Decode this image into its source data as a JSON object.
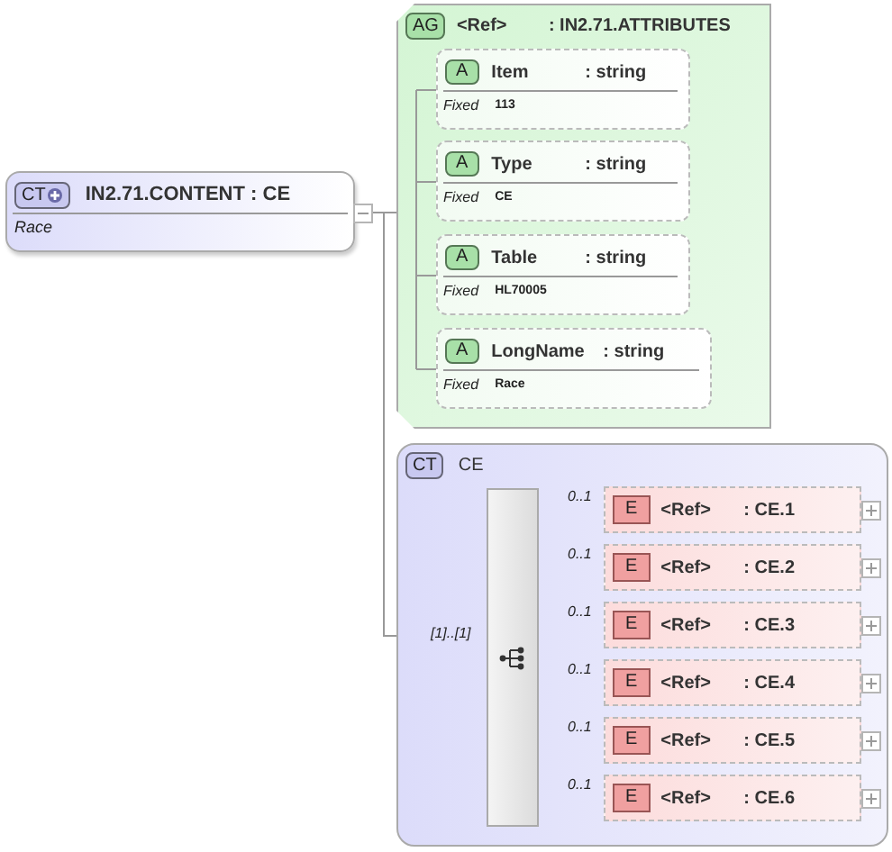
{
  "root": {
    "badge": "CT",
    "name": "IN2.71.CONTENT : CE",
    "annotation": "Race",
    "expanded": true
  },
  "attribute_group": {
    "badge": "AG",
    "ref": "<Ref>",
    "type": ": IN2.71.ATTRIBUTES",
    "attributes": [
      {
        "badge": "A",
        "name": "Item",
        "type": ": string",
        "fixed_label": "Fixed",
        "value": "113"
      },
      {
        "badge": "A",
        "name": "Type",
        "type": ": string",
        "fixed_label": "Fixed",
        "value": "CE"
      },
      {
        "badge": "A",
        "name": "Table",
        "type": ": string",
        "fixed_label": "Fixed",
        "value": "HL70005"
      },
      {
        "badge": "A",
        "name": "LongName",
        "type": ": string",
        "fixed_label": "Fixed",
        "value": "Race"
      }
    ]
  },
  "complex_type": {
    "badge": "CT",
    "name": "CE",
    "occurrence": "[1]..[1]",
    "elements": [
      {
        "cardinality": "0..1",
        "badge": "E",
        "ref": "<Ref>",
        "type": ": CE.1",
        "expanded": false
      },
      {
        "cardinality": "0..1",
        "badge": "E",
        "ref": "<Ref>",
        "type": ": CE.2",
        "expanded": false
      },
      {
        "cardinality": "0..1",
        "badge": "E",
        "ref": "<Ref>",
        "type": ": CE.3",
        "expanded": false
      },
      {
        "cardinality": "0..1",
        "badge": "E",
        "ref": "<Ref>",
        "type": ": CE.4",
        "expanded": false
      },
      {
        "cardinality": "0..1",
        "badge": "E",
        "ref": "<Ref>",
        "type": ": CE.5",
        "expanded": false
      },
      {
        "cardinality": "0..1",
        "badge": "E",
        "ref": "<Ref>",
        "type": ": CE.6",
        "expanded": false
      }
    ]
  }
}
